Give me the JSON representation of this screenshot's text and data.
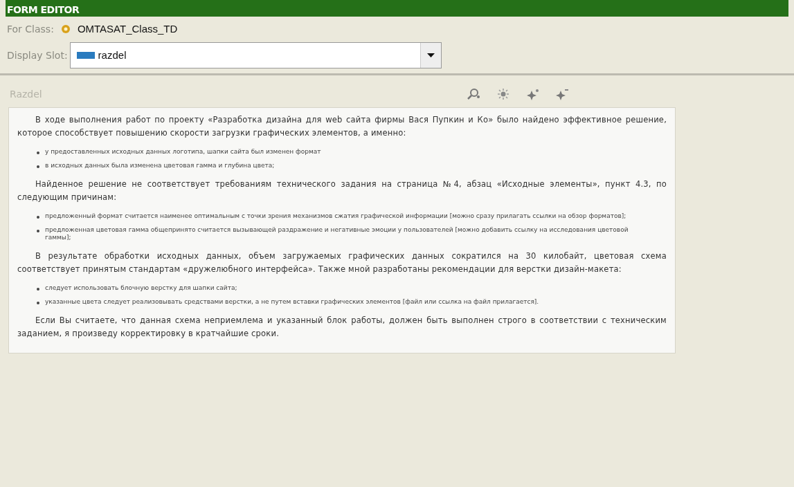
{
  "header": {
    "title": "FORM EDITOR"
  },
  "for_class": {
    "label": "For Class:",
    "value": "OMTASAT_Class_TD"
  },
  "display_slot": {
    "label": "Display Slot:",
    "value": "razdel"
  },
  "section": {
    "title": "Razdel"
  },
  "content": [
    {
      "kind": "paragraph",
      "text": "В ходе выполнения работ по проекту «Разработка дизайна для web сайта фирмы Вася Пупкин и Ко» было найдено эффективное решение, которое способствует повышению скорости загрузки графических элементов, а именно:"
    },
    {
      "kind": "list",
      "items": [
        "у предоставленных исходных данных логотипа, шапки сайта был изменен формат",
        "в исходных данных была изменена цветовая гамма и глубина цвета;"
      ]
    },
    {
      "kind": "paragraph",
      "text": "Найденное решение не соответствует требованиям технического задания на страница №4, абзац «Исходные элементы», пункт 4.3, по следующим причинам:"
    },
    {
      "kind": "list",
      "items": [
        "предложенный формат считается наименее оптимальным с точки зрения механизмов сжатия графической информации [можно сразу прилагать ссылки на обзор форматов];",
        "предложенная цветовая гамма общепринято считается вызывающей раздражение и негативные эмоции у пользователей [можно добавить ссылку на исследования цветовой гаммы];"
      ]
    },
    {
      "kind": "paragraph",
      "text": "В результате обработки исходных данных, объем загружаемых графических данных сократился на 30 килобайт, цветовая схема соответствует принятым стандартам «дружелюбного интерфейса». Также мной разработаны рекомендации для верстки дизайн-макета:"
    },
    {
      "kind": "list",
      "items": [
        "следует использовать блочную верстку для шапки сайта;",
        "указанные цвета следует реализовывать средствами верстки, а не путем вставки графических элементов [файл или ссылка на файл прилагается]."
      ]
    },
    {
      "kind": "paragraph",
      "text": "Если Вы считаете, что данная схема неприемлема и указанный блок работы, должен быть выполнен строго в соответствии с техническим заданием, я произведу корректировку в кратчайшие сроки."
    }
  ]
}
